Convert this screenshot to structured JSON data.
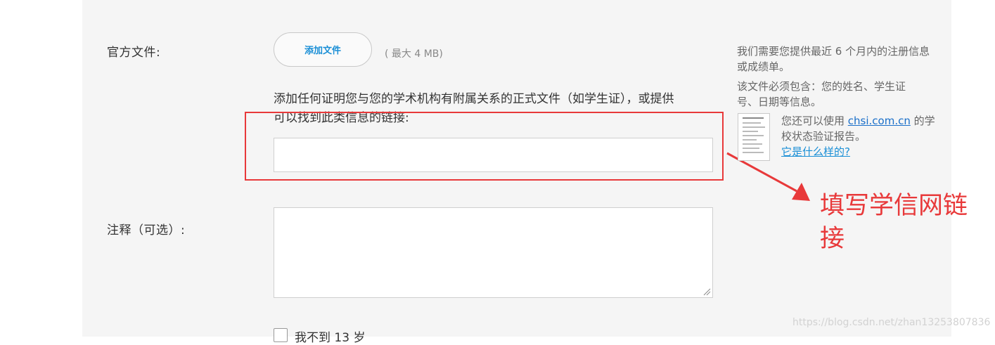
{
  "form": {
    "official_file_label": "官方文件:",
    "add_file_button": "添加文件",
    "max_size": "( 最大 4 MB)",
    "description": "添加任何证明您与您的学术机构有附属关系的正式文件（如学生证），或提供可以找到此类信息的链接:",
    "link_input_value": "",
    "notes_label": "注释（可选）:",
    "notes_value": "",
    "under13_label": "我不到 13 岁"
  },
  "sidebar": {
    "p1": "我们需要您提供最近 6 个月内的注册信息或成绩单。",
    "p2": "该文件必须包含：您的姓名、学生证号、日期等信息。",
    "p3_before": "您还可以使用 ",
    "p3_link": "chsi.com.cn",
    "p3_after": " 的学校状态验证报告。",
    "what_link": "它是什么样的?"
  },
  "annotation": {
    "text": "填写学信网链接",
    "color": "#e8393a"
  },
  "watermark": "https://blog.csdn.net/zhan13253807836",
  "colors": {
    "panel_bg": "#f5f5f5",
    "link_blue": "#1a8fd6",
    "annotation_red": "#e8393a"
  },
  "icons": {
    "doc_thumbnail": "document-preview-icon",
    "resize_grip": "resize-grip-icon",
    "arrow": "annotation-arrow-icon"
  }
}
